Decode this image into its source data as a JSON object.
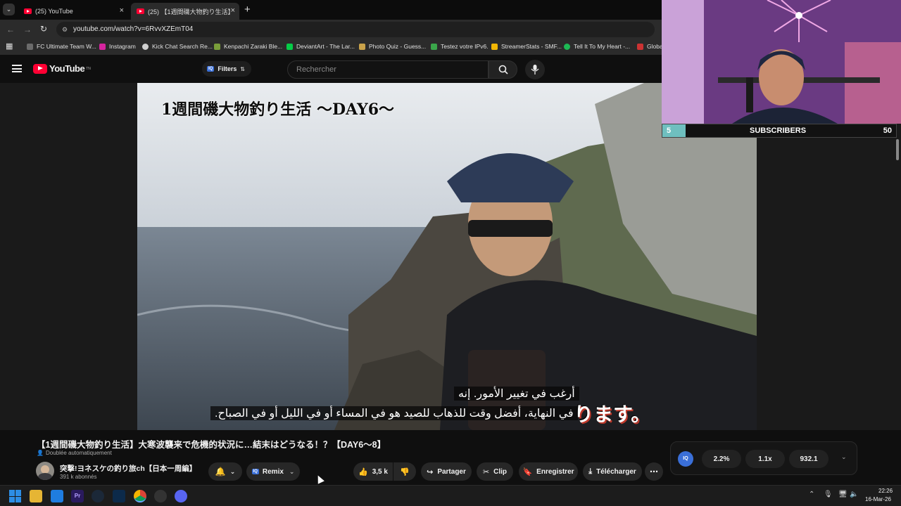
{
  "browser": {
    "tabs": [
      {
        "title": "(25) YouTube"
      },
      {
        "title": "(25) 【1週間磯大物釣り生活】大寒"
      }
    ],
    "new_tab_glyph": "+",
    "close_glyph": "×",
    "url": "youtube.com/watch?v=6RvvXZEmT04",
    "bookmarks": [
      {
        "label": "FC Ultimate Team W...",
        "color": "#6b6b6b"
      },
      {
        "label": "Instagram",
        "color": "#d6249f"
      },
      {
        "label": "Kick Chat Search Re...",
        "color": "#d0d0d0"
      },
      {
        "label": "Kenpachi Zaraki Ble...",
        "color": "#7a9e3a"
      },
      {
        "label": "DeviantArt - The Lar...",
        "color": "#05cc47"
      },
      {
        "label": "Photo Quiz - Guess...",
        "color": "#c9a24a"
      },
      {
        "label": "Testez votre IPv6.",
        "color": "#3aa64a"
      },
      {
        "label": "StreamerStats - SMF...",
        "color": "#f2b705"
      },
      {
        "label": "Tell It To My Heart -...",
        "color": "#1db954"
      },
      {
        "label": "Globa",
        "color": "#cc3333"
      }
    ]
  },
  "youtube": {
    "logo_text": "YouTube",
    "logo_sup": "TN",
    "filters_label": "Filters",
    "search_placeholder": "Rechercher",
    "iq_badge": "IQ"
  },
  "video": {
    "title_overlay": "1週間磯大物釣り生活 ～DAY6～",
    "subtitle_line1": "أرغب في تغيير الأمور. إنه",
    "subtitle_line2": "في النهاية، أفضل وقت للذهاب للصيد هو في المساء أو في الليل أو في الصباح.",
    "burned_caption": "ります。"
  },
  "overlay": {
    "subs_current": "5",
    "subs_label": "SUBSCRIBERS",
    "subs_goal": "50",
    "subs_progress": 0.1
  },
  "watch": {
    "title": "【1週間磯大物釣り生活】大寒波襲来で危機的状況に…結末はどうなる！？【DAY6〜8】",
    "dub_note": "Doublée automatiquement",
    "channel_name": "突撃!ヨネスケの釣り旅ch【日本一周編】",
    "subscribers": "391 k abonnés",
    "remix_label": "Remix",
    "likes": "3,5 k",
    "share_label": "Partager",
    "clip_label": "Clip",
    "save_label": "Enregistrer",
    "download_label": "Télécharger",
    "stats": [
      "2.2%",
      "1.1x",
      "932.1"
    ]
  },
  "taskbar": {
    "time": "22:26",
    "date": "16-Mar-26"
  }
}
